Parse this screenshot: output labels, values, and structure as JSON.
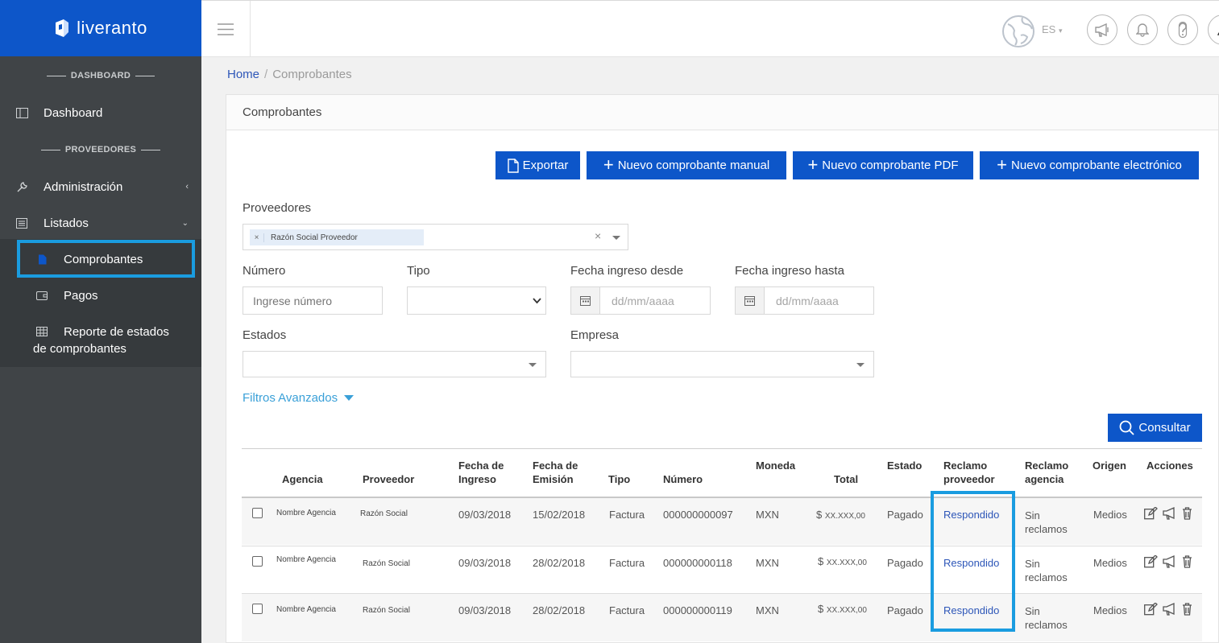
{
  "brand": {
    "name": "liveranto"
  },
  "sidebar": {
    "sections": [
      "DASHBOARD",
      "PROVEEDORES"
    ],
    "items": [
      {
        "label": "Dashboard"
      },
      {
        "label": "Administración"
      },
      {
        "label": "Listados"
      }
    ],
    "subitems": [
      {
        "label": "Comprobantes"
      },
      {
        "label": "Pagos"
      },
      {
        "label": "Reporte de estados"
      },
      {
        "label": "de comprobantes"
      }
    ]
  },
  "topbar": {
    "lang": "ES"
  },
  "breadcrumb": {
    "home": "Home",
    "sep": "/",
    "current": "Comprobantes"
  },
  "card": {
    "title": "Comprobantes"
  },
  "buttons": {
    "export": "Exportar",
    "manual": "Nuevo comprobante manual",
    "pdf": "Nuevo comprobante PDF",
    "electronic": "Nuevo comprobante electrónico",
    "query": "Consultar"
  },
  "filters": {
    "proveedores_label": "Proveedores",
    "proveedores_tag": "Razón Social Proveedor",
    "numero_label": "Número",
    "numero_placeholder": "Ingrese número",
    "tipo_label": "Tipo",
    "desde_label": "Fecha ingreso desde",
    "hasta_label": "Fecha ingreso hasta",
    "date_placeholder": "dd/mm/aaaa",
    "estados_label": "Estados",
    "empresa_label": "Empresa",
    "advanced": "Filtros Avanzados"
  },
  "table": {
    "headers": {
      "agencia": "Agencia",
      "proveedor": "Proveedor",
      "fecha_ingreso": [
        "Fecha de",
        "Ingreso"
      ],
      "fecha_emision": [
        "Fecha de",
        "Emisión"
      ],
      "tipo": "Tipo",
      "numero": "Número",
      "moneda": "Moneda",
      "total": "Total",
      "estado": "Estado",
      "reclamo_proveedor": [
        "Reclamo",
        "proveedor"
      ],
      "reclamo_agencia": [
        "Reclamo",
        "agencia"
      ],
      "origen": "Origen",
      "acciones": "Acciones"
    },
    "rows": [
      {
        "agencia": "Nombre Agencia",
        "proveedor": "Razón Social",
        "ingreso": "09/03/2018",
        "emision": "15/02/2018",
        "tipo": "Factura",
        "numero": "000000000097",
        "moneda": "MXN",
        "total_sym": "$",
        "total": "XX.XXX,00",
        "estado": "Pagado",
        "reclamo_prov": "Respondido",
        "reclamo_ag1": "Sin",
        "reclamo_ag2": "reclamos",
        "origen": "Medios"
      },
      {
        "agencia": "Nombre Agencia",
        "proveedor": "Razón Social",
        "ingreso": "09/03/2018",
        "emision": "28/02/2018",
        "tipo": "Factura",
        "numero": "000000000118",
        "moneda": "MXN",
        "total_sym": "$",
        "total": "XX.XXX,00",
        "estado": "Pagado",
        "reclamo_prov": "Respondido",
        "reclamo_ag1": "Sin",
        "reclamo_ag2": "reclamos",
        "origen": "Medios"
      },
      {
        "agencia": "Nombre Agencia",
        "proveedor": "Razón Social",
        "ingreso": "09/03/2018",
        "emision": "28/02/2018",
        "tipo": "Factura",
        "numero": "000000000119",
        "moneda": "MXN",
        "total_sym": "$",
        "total": "XX.XXX,00",
        "estado": "Pagado",
        "reclamo_prov": "Respondido",
        "reclamo_ag1": "Sin",
        "reclamo_ag2": "reclamos",
        "origen": "Medios"
      }
    ]
  },
  "colors": {
    "primary": "#0d56c9",
    "sidebar": "#404447",
    "highlight": "#1a9ce0",
    "link": "#2d56b8"
  }
}
